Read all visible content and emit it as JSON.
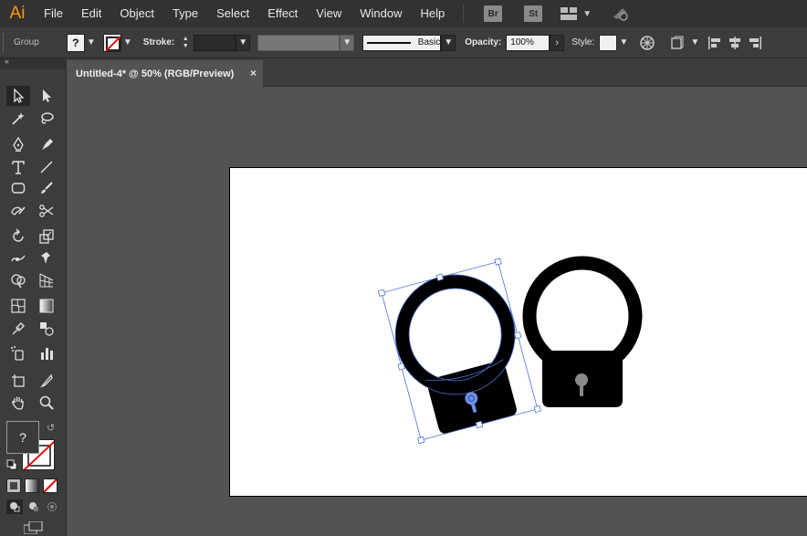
{
  "app": {
    "logo": "Ai"
  },
  "menubar": {
    "items": [
      "File",
      "Edit",
      "Object",
      "Type",
      "Select",
      "Effect",
      "View",
      "Window",
      "Help"
    ],
    "bridge_label": "Br",
    "stock_label": "St"
  },
  "controlbar": {
    "selection_label": "Group",
    "fill_label": "?",
    "stroke_label": "Stroke:",
    "brush_label": "Basic",
    "opacity_label": "Opacity:",
    "opacity_value": "100%",
    "style_label": "Style:"
  },
  "tabs": [
    {
      "label": "Untitled-4* @ 50% (RGB/Preview)",
      "close": "×"
    }
  ],
  "tools": {
    "fill_label": "?"
  },
  "colors": {
    "accent": "#ff9a00",
    "selection": "#4a73d6",
    "shape": "#000000",
    "keyhole": "#888888"
  }
}
